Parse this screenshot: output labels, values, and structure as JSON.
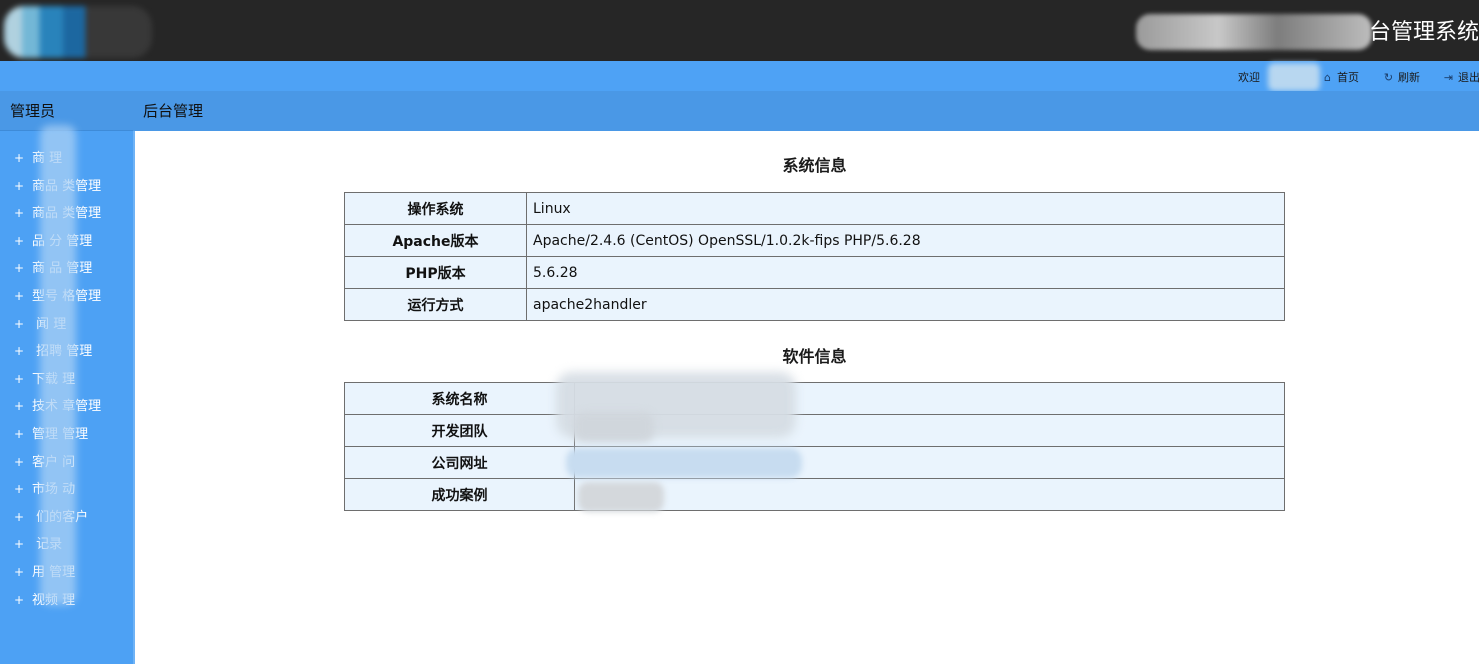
{
  "header": {
    "system_title": "台管理系统",
    "welcome": "欢迎",
    "home_label": "首页",
    "refresh_label": "刷新",
    "logout_label": "退出"
  },
  "sidebar": {
    "title": "管理员",
    "items": [
      {
        "label": "商  理"
      },
      {
        "label": "商品  类管理"
      },
      {
        "label": "商品  类管理"
      },
      {
        "label": "品  分  管理"
      },
      {
        "label": "商  品  管理"
      },
      {
        "label": "型号  格管理"
      },
      {
        "label": "  闻  理"
      },
      {
        "label": "  招聘  管理"
      },
      {
        "label": "下载  理"
      },
      {
        "label": "技术  章管理"
      },
      {
        "label": "管理  管理"
      },
      {
        "label": "客户  问"
      },
      {
        "label": "市场  动"
      },
      {
        "label": "  们的客户"
      },
      {
        "label": "  记录"
      },
      {
        "label": "用  管理"
      },
      {
        "label": "视频  理"
      }
    ]
  },
  "page": {
    "title": "后台管理"
  },
  "system_info": {
    "title": "系统信息",
    "rows": [
      {
        "key": "操作系统",
        "value": "Linux"
      },
      {
        "key": "Apache版本",
        "value": "Apache/2.4.6 (CentOS) OpenSSL/1.0.2k-fips PHP/5.6.28"
      },
      {
        "key": "PHP版本",
        "value": "5.6.28"
      },
      {
        "key": "运行方式",
        "value": "apache2handler"
      }
    ]
  },
  "software_info": {
    "title": "软件信息",
    "rows": [
      {
        "key": "系统名称",
        "value": ""
      },
      {
        "key": "开发团队",
        "value": ""
      },
      {
        "key": "公司网址",
        "value": ""
      },
      {
        "key": "成功案例",
        "value": ""
      }
    ]
  },
  "colors": {
    "topbar": "#262626",
    "header_strip": "#4ea2f5",
    "sidebar": "#4da1f4",
    "table_bg": "#eaf4fd"
  },
  "icons": {
    "home": "home-icon",
    "refresh": "refresh-icon",
    "logout": "logout-icon"
  }
}
